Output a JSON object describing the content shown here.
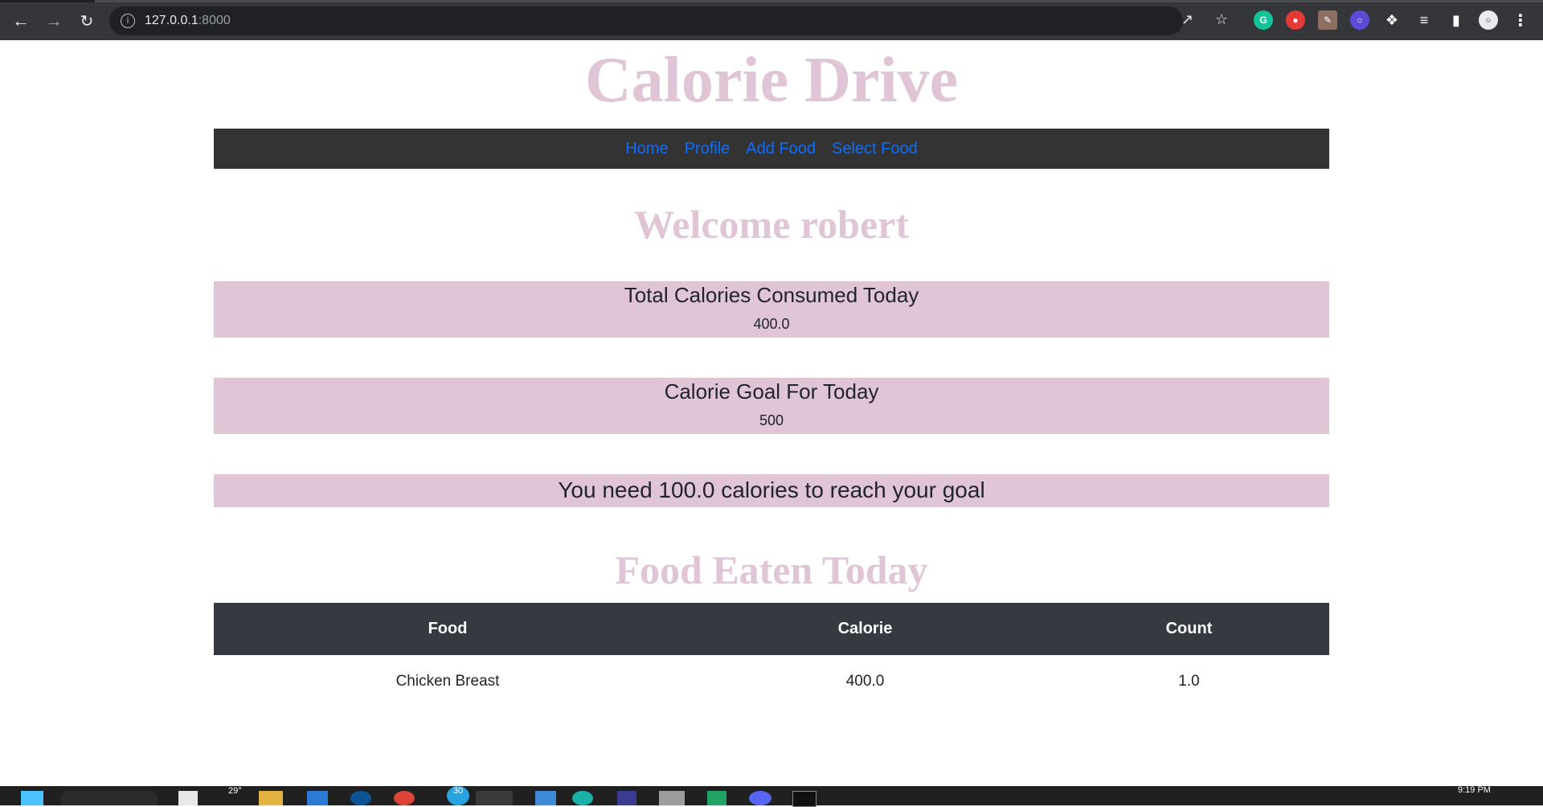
{
  "browser": {
    "url_host": "127.0.0.1",
    "url_port": ":8000"
  },
  "site": {
    "title": "Calorie Drive",
    "nav": [
      "Home",
      "Profile",
      "Add Food",
      "Select Food"
    ]
  },
  "welcome": "Welcome robert",
  "total_card": {
    "title": "Total Calories Consumed Today",
    "value": "400.0"
  },
  "goal_card": {
    "title": "Calorie Goal For Today",
    "value": "500"
  },
  "need_message": "You need 100.0 calories to reach your goal",
  "food_section": {
    "heading": "Food Eaten Today",
    "columns": [
      "Food",
      "Calorie",
      "Count"
    ],
    "rows": [
      [
        "Chicken Breast",
        "400.0",
        "1.0"
      ]
    ]
  },
  "taskbar": {
    "weather": "29°",
    "badge_count": "30",
    "time": "9:19 PM"
  },
  "colors": {
    "accent_pink": "#e0c5d7",
    "nav_bg": "#333333",
    "link_blue": "#0d6efd",
    "table_head_bg": "#343a40"
  }
}
